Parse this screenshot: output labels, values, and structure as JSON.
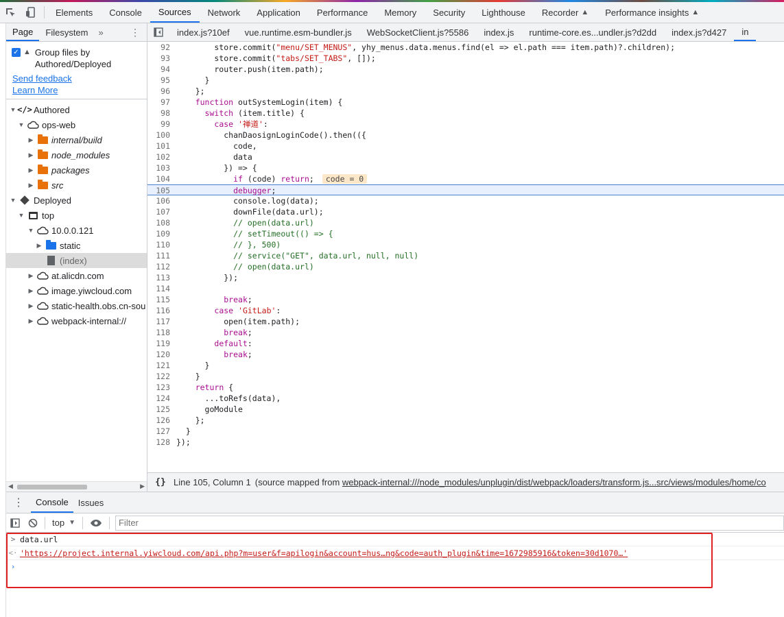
{
  "top_tabs": [
    "Elements",
    "Console",
    "Sources",
    "Network",
    "Application",
    "Performance",
    "Memory",
    "Security",
    "Lighthouse",
    "Recorder",
    "Performance insights"
  ],
  "nav": {
    "tabs": [
      "Page",
      "Filesystem"
    ],
    "group_label": "Group files by Authored/Deployed",
    "send_feedback": "Send feedback",
    "learn_more": "Learn More",
    "tree": [
      {
        "label": "Authored",
        "icon": "code-icon"
      },
      {
        "label": "ops-web",
        "icon": "cloud-icon"
      },
      {
        "label": "internal/build",
        "icon": "folder-icon"
      },
      {
        "label": "node_modules",
        "icon": "folder-icon"
      },
      {
        "label": "packages",
        "icon": "folder-icon"
      },
      {
        "label": "src",
        "icon": "folder-icon"
      },
      {
        "label": "Deployed",
        "icon": "cube-icon"
      },
      {
        "label": "top",
        "icon": "frame-icon"
      },
      {
        "label": "10.0.0.121",
        "icon": "cloud-icon"
      },
      {
        "label": "static",
        "icon": "folder-icon"
      },
      {
        "label": "(index)",
        "icon": "file-icon"
      },
      {
        "label": "at.alicdn.com",
        "icon": "cloud-icon"
      },
      {
        "label": "image.yiwcloud.com",
        "icon": "cloud-icon"
      },
      {
        "label": "static-health.obs.cn-sou",
        "icon": "cloud-icon"
      },
      {
        "label": "webpack-internal://",
        "icon": "cloud-icon"
      }
    ]
  },
  "editor": {
    "tabs": [
      "index.js?10ef",
      "vue.runtime.esm-bundler.js",
      "WebSocketClient.js?5586",
      "index.js",
      "runtime-core.es...undler.js?d2dd",
      "index.js?d427",
      "in"
    ],
    "inline_value": "code = 0",
    "lines": [
      {
        "n": "92",
        "t": "        store.commit(\"menu/SET_MENUS\", yhy_menus.data.menus.find(el => el.path === item.path)?.children);"
      },
      {
        "n": "93",
        "t": "        store.commit(\"tabs/SET_TABS\", []);"
      },
      {
        "n": "94",
        "t": "        router.push(item.path);"
      },
      {
        "n": "95",
        "t": "      }"
      },
      {
        "n": "96",
        "t": "    };"
      },
      {
        "n": "97",
        "t": "    function outSystemLogin(item) {"
      },
      {
        "n": "98",
        "t": "      switch (item.title) {"
      },
      {
        "n": "99",
        "t": "        case '禅道':"
      },
      {
        "n": "100",
        "t": "          chanDaosignLoginCode().then(({"
      },
      {
        "n": "101",
        "t": "            code,"
      },
      {
        "n": "102",
        "t": "            data"
      },
      {
        "n": "103",
        "t": "          }) => {"
      },
      {
        "n": "104",
        "t": "            if (code) return;"
      },
      {
        "n": "105",
        "t": "            debugger;"
      },
      {
        "n": "106",
        "t": "            console.log(data);"
      },
      {
        "n": "107",
        "t": "            downFile(data.url);"
      },
      {
        "n": "108",
        "t": "            // open(data.url)"
      },
      {
        "n": "109",
        "t": "            // setTimeout(() => {"
      },
      {
        "n": "110",
        "t": "            // }, 500)"
      },
      {
        "n": "111",
        "t": "            // service(\"GET\", data.url, null, null)"
      },
      {
        "n": "112",
        "t": "            // open(data.url)"
      },
      {
        "n": "113",
        "t": "          });"
      },
      {
        "n": "114",
        "t": ""
      },
      {
        "n": "115",
        "t": "          break;"
      },
      {
        "n": "116",
        "t": "        case 'GitLab':"
      },
      {
        "n": "117",
        "t": "          open(item.path);"
      },
      {
        "n": "118",
        "t": "          break;"
      },
      {
        "n": "119",
        "t": "        default:"
      },
      {
        "n": "120",
        "t": "          break;"
      },
      {
        "n": "121",
        "t": "      }"
      },
      {
        "n": "122",
        "t": "    }"
      },
      {
        "n": "123",
        "t": "    return {"
      },
      {
        "n": "124",
        "t": "      ...toRefs(data),"
      },
      {
        "n": "125",
        "t": "      goModule"
      },
      {
        "n": "126",
        "t": "    };"
      },
      {
        "n": "127",
        "t": "  }"
      },
      {
        "n": "128",
        "t": "});"
      }
    ]
  },
  "status": {
    "pretty_print": "{}",
    "position": "Line 105, Column 1",
    "source_prefix": "(source mapped from ",
    "source_link": "webpack-internal:///node_modules/unplugin/dist/webpack/loaders/transform.js...src/views/modules/home/co"
  },
  "drawer": {
    "tabs": [
      "Console",
      "Issues"
    ],
    "context": "top",
    "filter_placeholder": "Filter"
  },
  "console": {
    "input": "data.url",
    "result": "'https://project.internal.yiwcloud.com/api.php?m=user&f=apilogin&account=hus…ng&code=auth_plugin&time=1672985916&token=30d1070…'"
  },
  "colors": {
    "accent": "#1a73e8",
    "folder": "#e8710a",
    "highlight_box": "#e02020"
  }
}
